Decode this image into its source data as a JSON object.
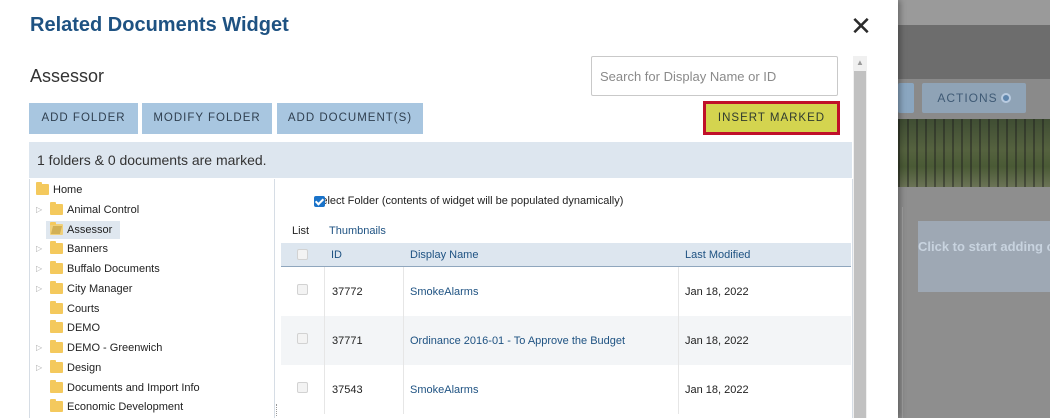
{
  "background": {
    "actions_label": "ACTIONS",
    "hint_text": "Click to start adding content."
  },
  "modal": {
    "title": "Related Documents Widget",
    "close_symbol": "✕",
    "folder_title": "Assessor",
    "search": {
      "placeholder": "Search for Display Name or ID",
      "value": ""
    },
    "buttons": {
      "add_folder": "ADD FOLDER",
      "modify_folder": "MODIFY FOLDER",
      "add_documents": "ADD DOCUMENT(S)",
      "insert_marked": "INSERT MARKED"
    },
    "marked_status": "1 folders & 0 documents are marked.",
    "tree": [
      {
        "label": "Home",
        "expandable": false,
        "level": 0
      },
      {
        "label": "Animal Control",
        "expandable": true,
        "level": 1
      },
      {
        "label": "Assessor",
        "expandable": false,
        "level": 1,
        "selected": true
      },
      {
        "label": "Banners",
        "expandable": true,
        "level": 1
      },
      {
        "label": "Buffalo Documents",
        "expandable": true,
        "level": 1
      },
      {
        "label": "City Manager",
        "expandable": true,
        "level": 1
      },
      {
        "label": "Courts",
        "expandable": false,
        "level": 1
      },
      {
        "label": "DEMO",
        "expandable": false,
        "level": 1
      },
      {
        "label": "DEMO - Greenwich",
        "expandable": true,
        "level": 1
      },
      {
        "label": "Design",
        "expandable": true,
        "level": 1
      },
      {
        "label": "Documents and Import Info",
        "expandable": false,
        "level": 1
      },
      {
        "label": "Economic Development",
        "expandable": false,
        "level": 1
      }
    ],
    "select_folder_label": "Select Folder (contents of widget will be populated dynamically)",
    "select_folder_checked": true,
    "views": {
      "list": "List",
      "thumbnails": "Thumbnails"
    },
    "table": {
      "columns": {
        "id": "ID",
        "display_name": "Display Name",
        "last_modified": "Last Modified"
      },
      "rows": [
        {
          "id": "37772",
          "display_name": "SmokeAlarms",
          "last_modified": "Jan 18, 2022"
        },
        {
          "id": "37771",
          "display_name": "Ordinance 2016-01 - To Approve the Budget",
          "last_modified": "Jan 18, 2022"
        },
        {
          "id": "37543",
          "display_name": "SmokeAlarms",
          "last_modified": "Jan 18, 2022"
        }
      ]
    },
    "colors": {
      "title": "#1e5282",
      "button_bg": "#a8c6e0",
      "insert_bg": "#d4d44f",
      "insert_border": "#c0102a",
      "status_bar": "#dde6ef",
      "folder_icon": "#f4c95d"
    }
  }
}
